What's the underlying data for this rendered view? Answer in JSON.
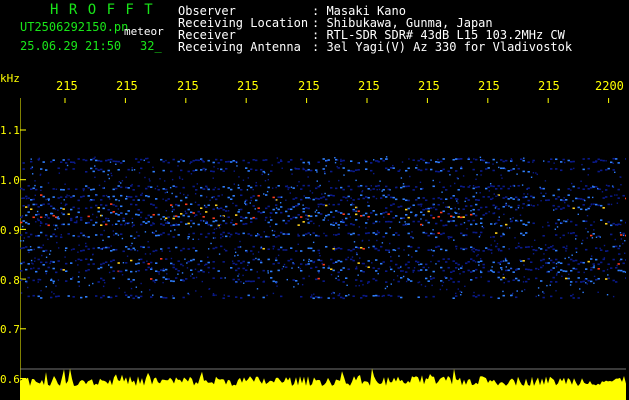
{
  "header": {
    "brand": "H R O F F T",
    "filename": "UT2506292150.pn",
    "meteor_label": "meteor",
    "datetime": "25.06.29 21:50",
    "count": "32_",
    "info": [
      {
        "label": "Observer",
        "value": ": Masaki Kano"
      },
      {
        "label": "Receiving Location",
        "value": ": Shibukawa, Gunma, Japan"
      },
      {
        "label": "Receiver",
        "value": ": RTL-SDR SDR# 43dB L15 103.2MHz CW"
      },
      {
        "label": "Receiving Antenna",
        "value": ": 3el Yagi(V) Az 330 for Vladivostok"
      }
    ]
  },
  "time_axis": {
    "ticks": [
      "215",
      "215",
      "215",
      "215",
      "215",
      "215",
      "215",
      "215",
      "215",
      "2200"
    ]
  },
  "freq_axis": {
    "unit": "kHz",
    "ticks": [
      "1.1",
      "1.0",
      "0.9",
      "0.8",
      "0.7",
      "0.6"
    ]
  },
  "colors": {
    "header_green": "#19e619",
    "text_white": "#ffffff",
    "axis_yellow": "#ffff00",
    "background": "#000000",
    "signal_dark": "#0a1a8c",
    "signal_mid": "#2f7fff",
    "signal_hot": "#ff3c1e",
    "signal_warm": "#ffd21e"
  }
}
